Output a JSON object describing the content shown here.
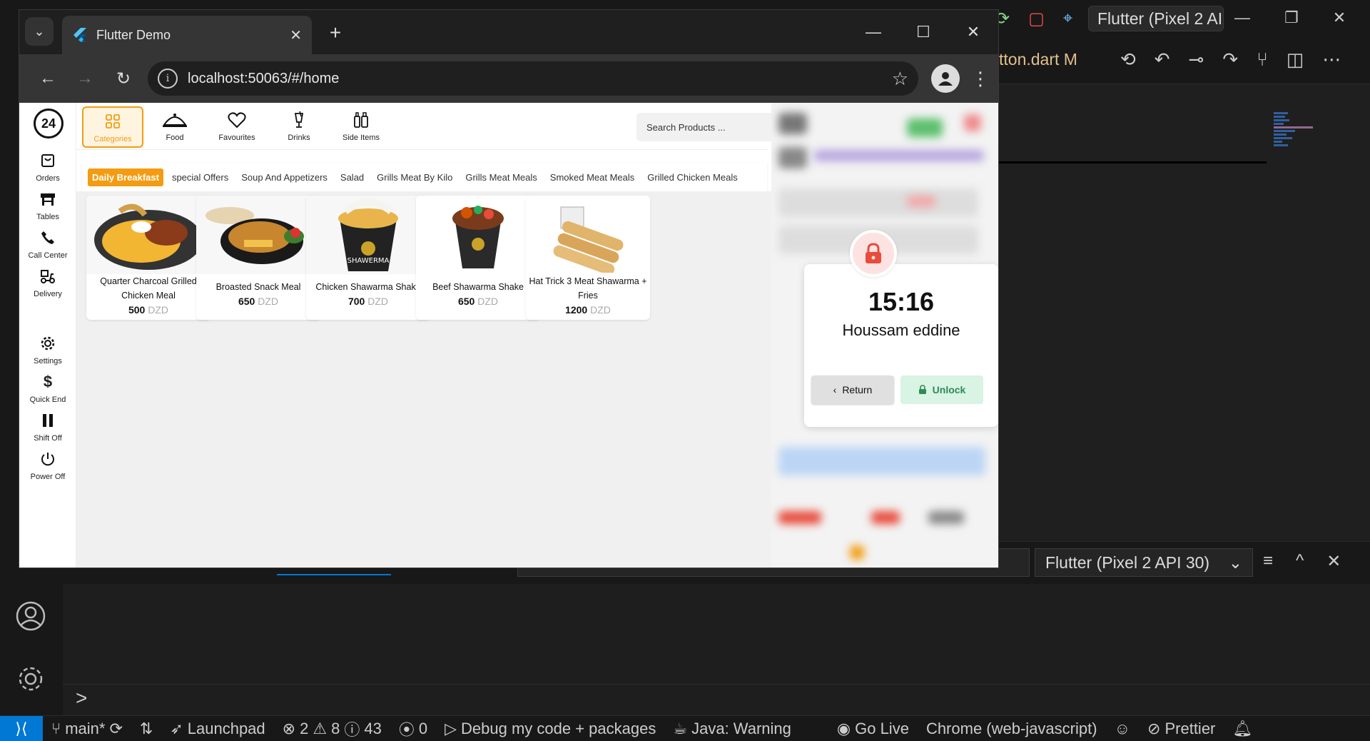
{
  "vscode": {
    "title_pill": "Flutter (Pixel 2 AI",
    "editor_tab": "tton.dart",
    "editor_tab_badge": "M",
    "panel_device": "Flutter (Pixel 2 API 30)",
    "prompt": ">"
  },
  "statusbar": {
    "branch": "main*",
    "launchpad": "Launchpad",
    "errors": "2",
    "warnings": "8",
    "infos": "43",
    "ports": "0",
    "debug": "Debug my code + packages",
    "java": "Java: Warning",
    "golive": "Go Live",
    "chrome": "Chrome (web-javascript)",
    "prettier": "Prettier"
  },
  "browser": {
    "tab_title": "Flutter Demo",
    "url_host": "localhost",
    "url_rest": ":50063/#/home"
  },
  "app": {
    "logo": "24",
    "side_nav": [
      {
        "label": "Orders"
      },
      {
        "label": "Tables"
      },
      {
        "label": "Call Center"
      },
      {
        "label": "Delivery"
      },
      {
        "label": "Settings"
      },
      {
        "label": "Quick End"
      },
      {
        "label": "Shift Off"
      },
      {
        "label": "Power Off"
      }
    ],
    "top_tabs": [
      {
        "label": "Categories"
      },
      {
        "label": "Food"
      },
      {
        "label": "Favourites"
      },
      {
        "label": "Drinks"
      },
      {
        "label": "Side Items"
      }
    ],
    "search_placeholder": "Search Products ...",
    "categories": [
      "Daily Breakfast",
      "special Offers",
      "Soup And Appetizers",
      "Salad",
      "Grills Meat By Kilo",
      "Grills Meat Meals",
      "Smoked Meat Meals",
      "Grilled Chicken Meals"
    ],
    "currency": "DZD",
    "products": [
      {
        "name": "Quarter Charcoal Grilled Chicken Meal",
        "price": "500"
      },
      {
        "name": "Broasted Snack Meal",
        "price": "650"
      },
      {
        "name": "Chicken Shawarma Shake",
        "price": "700"
      },
      {
        "name": "Beef Shawarma Shake",
        "price": "650"
      },
      {
        "name": "Hat Trick 3 Meat Shawarma + Fries",
        "price": "1200"
      }
    ],
    "lock": {
      "time": "15:16",
      "user": "Houssam eddine",
      "return_label": "Return",
      "unlock_label": "Unlock"
    }
  },
  "colors": {
    "accent": "#f39c12",
    "vscode_blue": "#0078d4",
    "lock_red": "#e74c3c",
    "unlock_green": "#2e8b57"
  }
}
